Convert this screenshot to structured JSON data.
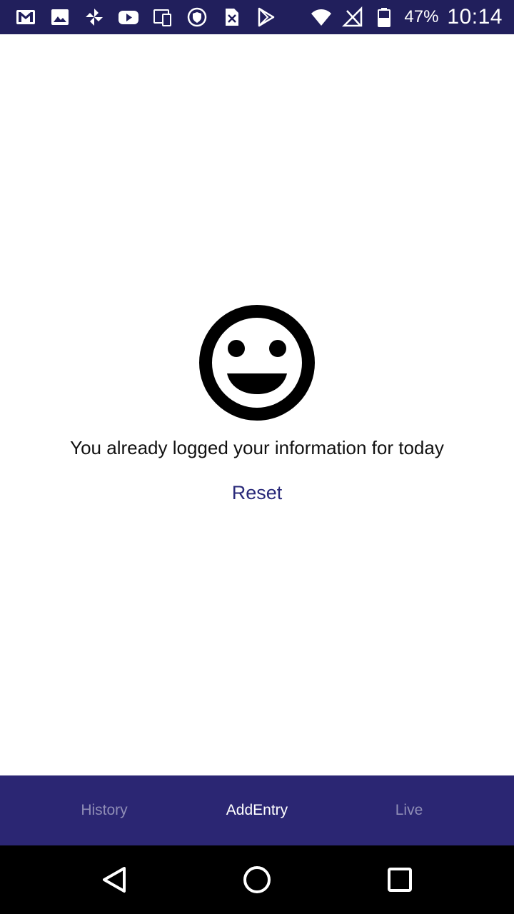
{
  "status_bar": {
    "icons": [
      "gmail-icon",
      "gallery-icon",
      "pinwheel-icon",
      "youtube-icon",
      "device-icon",
      "shield-icon",
      "sim-card-icon",
      "play-store-icon",
      "wifi-icon",
      "no-signal-icon",
      "battery-icon"
    ],
    "battery": "47%",
    "time": "10:14"
  },
  "main": {
    "icon": "smiley-face-icon",
    "message": "You already logged your information for today",
    "reset_label": "Reset"
  },
  "tabs": [
    {
      "label": "History",
      "active": false
    },
    {
      "label": "AddEntry",
      "active": true
    },
    {
      "label": "Live",
      "active": false
    }
  ],
  "nav": {
    "icons": [
      "back-icon",
      "home-icon",
      "recent-apps-icon"
    ]
  },
  "colors": {
    "status_bar_bg": "#211f5c",
    "tab_bar_bg": "#2b2673",
    "accent_text": "#2a2a7a",
    "inactive_tab": "#8f8db6"
  }
}
